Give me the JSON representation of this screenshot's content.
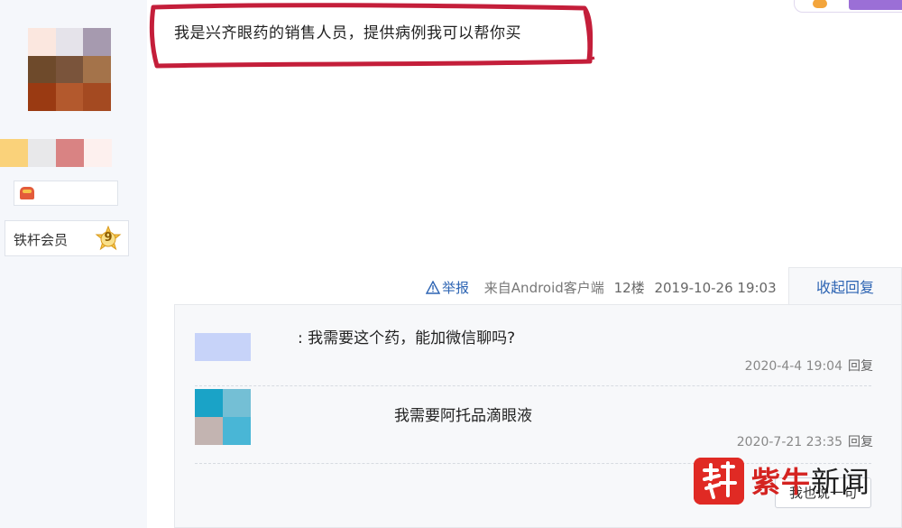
{
  "post": {
    "text": "我是兴齐眼药的销售人员，提供病例我可以帮你买",
    "meta": {
      "report_label": "举报",
      "source": "来自Android客户端",
      "floor": "12楼",
      "datetime": "2019-10-26 19:03"
    },
    "collapse_label": "收起回复",
    "highlight_color": "#c41e3a"
  },
  "author": {
    "member_title": "铁杆会员",
    "level": "9"
  },
  "replies": [
    {
      "text": ": 我需要这个药，能加微信聊吗?",
      "datetime": "2020-4-4 19:04",
      "reply_label": "回复"
    },
    {
      "text": "我需要阿托品滴眼液",
      "datetime": "2020-7-21 23:35",
      "reply_label": "回复"
    }
  ],
  "say_button": "我也说一句",
  "watermark": {
    "brand": "紫牛",
    "suffix": "新闻"
  },
  "colors": {
    "link": "#2d64b3",
    "panel_bg": "#f5f7fb",
    "reply_bg": "#f7f8fa",
    "watermark_red": "#d42320"
  }
}
